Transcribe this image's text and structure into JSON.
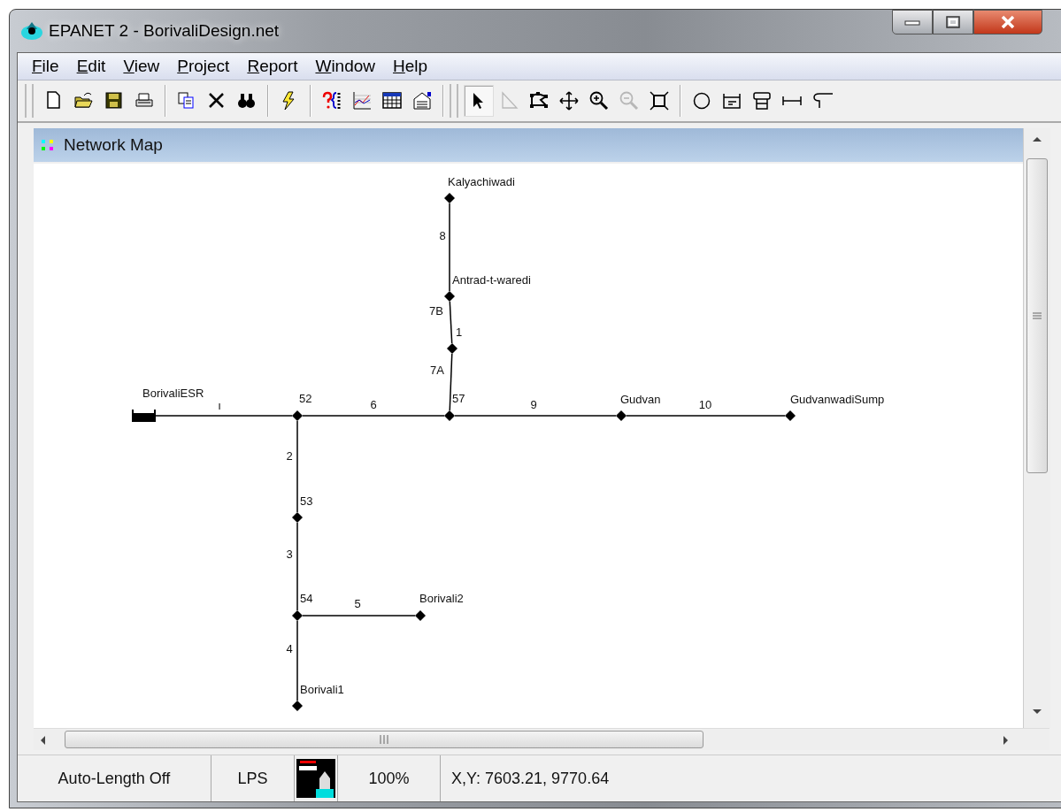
{
  "window": {
    "title": "EPANET 2 - BorivaliDesign.net"
  },
  "menu": [
    {
      "label": "File"
    },
    {
      "label": "Edit"
    },
    {
      "label": "View"
    },
    {
      "label": "Project"
    },
    {
      "label": "Report"
    },
    {
      "label": "Window"
    },
    {
      "label": "Help"
    }
  ],
  "toolbar": [
    [
      {
        "kind": "new"
      },
      {
        "kind": "open"
      },
      {
        "kind": "save"
      },
      {
        "kind": "print"
      }
    ],
    [
      {
        "kind": "copy"
      },
      {
        "kind": "delete"
      },
      {
        "kind": "find"
      }
    ],
    [
      {
        "kind": "run"
      }
    ],
    [
      {
        "kind": "query"
      },
      {
        "kind": "graph"
      },
      {
        "kind": "table"
      },
      {
        "kind": "options"
      }
    ]
  ],
  "map_toolbar": [
    [
      {
        "kind": "select",
        "selected": true,
        "disabled": false
      },
      {
        "kind": "vertex",
        "selected": false,
        "disabled": true
      },
      {
        "kind": "region",
        "selected": false,
        "disabled": false
      },
      {
        "kind": "pan",
        "selected": false,
        "disabled": false
      },
      {
        "kind": "zoomin",
        "selected": false,
        "disabled": false
      },
      {
        "kind": "zoomout",
        "selected": false,
        "disabled": true
      },
      {
        "kind": "extent",
        "selected": false,
        "disabled": false
      }
    ],
    [
      {
        "kind": "junction",
        "selected": false,
        "disabled": false
      },
      {
        "kind": "reservoir",
        "selected": false,
        "disabled": false
      },
      {
        "kind": "tank",
        "selected": false,
        "disabled": false
      },
      {
        "kind": "pipe",
        "selected": false,
        "disabled": false
      },
      {
        "kind": "pump",
        "selected": false,
        "disabled": false
      }
    ]
  ],
  "network_map": {
    "title": "Network Map",
    "nodes": [
      {
        "label": "Kalyachiwadi",
        "kind": "junction"
      },
      {
        "label": "Antrad-t-waredi",
        "kind": "junction"
      },
      {
        "label": "1",
        "kind": "junction"
      },
      {
        "label": "BorivaliESR",
        "kind": "tank"
      },
      {
        "label": "52",
        "kind": "junction"
      },
      {
        "label": "57",
        "kind": "junction"
      },
      {
        "label": "Gudvan",
        "kind": "junction"
      },
      {
        "label": "GudvanwadiSump",
        "kind": "junction"
      },
      {
        "label": "53",
        "kind": "junction"
      },
      {
        "label": "54",
        "kind": "junction"
      },
      {
        "label": "Borivali2",
        "kind": "junction"
      },
      {
        "label": "Borivali1",
        "kind": "junction"
      }
    ],
    "links": [
      {
        "label": "8"
      },
      {
        "label": "7B"
      },
      {
        "label": "7A"
      },
      {
        "label": "ı"
      },
      {
        "label": "6"
      },
      {
        "label": "9"
      },
      {
        "label": "10"
      },
      {
        "label": "2"
      },
      {
        "label": "3"
      },
      {
        "label": "5"
      },
      {
        "label": "4"
      }
    ]
  },
  "status_bar": {
    "auto_length": "Auto-Length Off",
    "flow_units": "LPS",
    "zoom": "100%",
    "coordinates": "X,Y: 7603.21, 9770.64"
  }
}
